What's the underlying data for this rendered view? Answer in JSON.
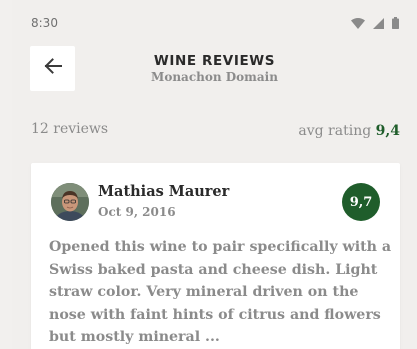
{
  "status_bar": {
    "time": "8:30",
    "icons": [
      "wifi-icon",
      "cellular-signal-icon",
      "battery-icon"
    ]
  },
  "header": {
    "back_icon": "arrow-left-icon",
    "title": "WINE REVIEWS",
    "subtitle": "Monachon Domain"
  },
  "summary": {
    "review_count": "12 reviews",
    "avg_label": "avg rating",
    "avg_value": "9,4"
  },
  "reviews": [
    {
      "reviewer": "Mathias Maurer",
      "date": "Oct 9, 2016",
      "rating": "9,7",
      "text": "Opened this wine to pair specifically with a Swiss baked pasta and cheese dish. Light straw color. Very mineral driven on the nose with faint hints of citrus and flowers but mostly mineral ..."
    }
  ],
  "colors": {
    "accent": "#1f5d2b",
    "background": "#f1efed",
    "muted_text": "#8b8b8b",
    "dark_text": "#2a2a2a"
  }
}
